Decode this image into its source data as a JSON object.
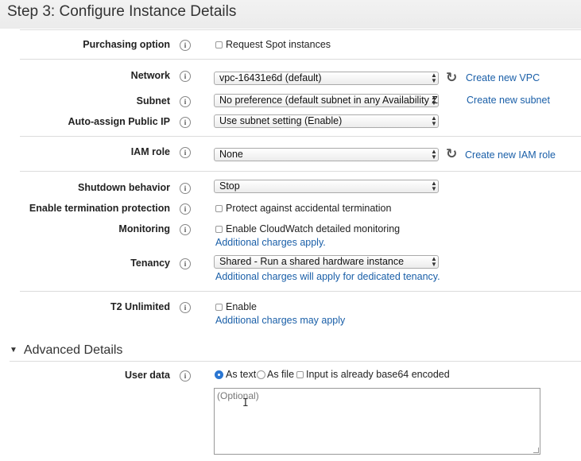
{
  "header": {
    "title": "Step 3: Configure Instance Details"
  },
  "purchasing": {
    "label": "Purchasing option",
    "spot_label": "Request Spot instances"
  },
  "network": {
    "label": "Network",
    "value": "vpc-16431e6d (default)",
    "create_link": "Create new VPC"
  },
  "subnet": {
    "label": "Subnet",
    "value": "No preference (default subnet in any Availability Zon",
    "create_link": "Create new subnet"
  },
  "public_ip": {
    "label": "Auto-assign Public IP",
    "value": "Use subnet setting (Enable)"
  },
  "iam": {
    "label": "IAM role",
    "value": "None",
    "create_link": "Create new IAM role"
  },
  "shutdown": {
    "label": "Shutdown behavior",
    "value": "Stop"
  },
  "termination": {
    "label": "Enable termination protection",
    "option": "Protect against accidental termination"
  },
  "monitoring": {
    "label": "Monitoring",
    "option": "Enable CloudWatch detailed monitoring",
    "note": "Additional charges apply."
  },
  "tenancy": {
    "label": "Tenancy",
    "value": "Shared - Run a shared hardware instance",
    "note": "Additional charges will apply for dedicated tenancy."
  },
  "t2": {
    "label": "T2 Unlimited",
    "option": "Enable",
    "note": "Additional charges may apply"
  },
  "advanced": {
    "title": "Advanced Details"
  },
  "userdata": {
    "label": "User data",
    "opt_text": "As text",
    "opt_file": "As file",
    "opt_base64": "Input is already base64 encoded",
    "placeholder": "(Optional)"
  },
  "icons": {
    "info": "info-icon",
    "refresh": "refresh-icon",
    "select_arrow": "select-arrows-icon",
    "expand": "triangle-down-icon"
  },
  "colors": {
    "link": "#1a5fa8",
    "radio_selected": "#2a76d2"
  }
}
